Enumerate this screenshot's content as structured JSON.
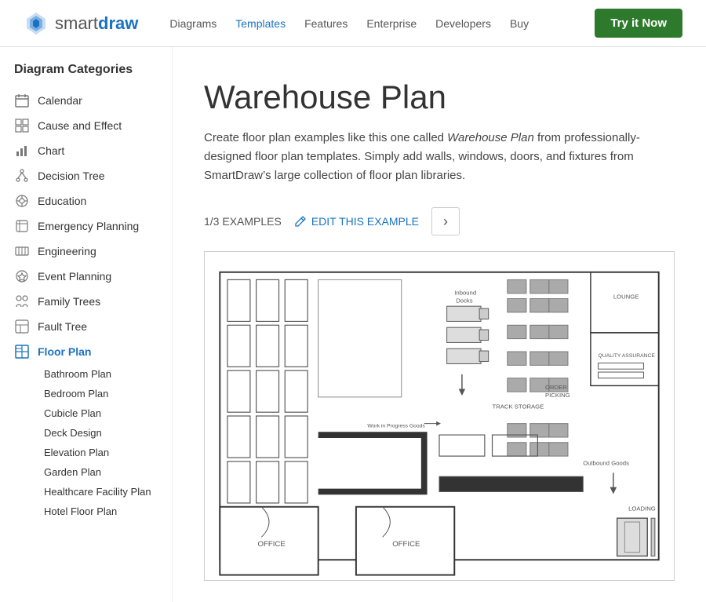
{
  "nav": {
    "brand_smart": "smart",
    "brand_draw": "draw",
    "links": [
      {
        "label": "Diagrams",
        "active": false
      },
      {
        "label": "Templates",
        "active": true
      },
      {
        "label": "Features",
        "active": false
      },
      {
        "label": "Enterprise",
        "active": false
      },
      {
        "label": "Developers",
        "active": false
      },
      {
        "label": "Buy",
        "active": false
      }
    ],
    "cta_label": "Try it Now"
  },
  "sidebar": {
    "title": "Diagram Categories",
    "items": [
      {
        "label": "Calendar",
        "icon": "calendar",
        "active": false
      },
      {
        "label": "Cause and Effect",
        "icon": "cause",
        "active": false
      },
      {
        "label": "Chart",
        "icon": "chart",
        "active": false
      },
      {
        "label": "Decision Tree",
        "icon": "tree",
        "active": false
      },
      {
        "label": "Education",
        "icon": "edu",
        "active": false
      },
      {
        "label": "Emergency Planning",
        "icon": "emergency",
        "active": false
      },
      {
        "label": "Engineering",
        "icon": "engineering",
        "active": false
      },
      {
        "label": "Event Planning",
        "icon": "event",
        "active": false
      },
      {
        "label": "Family Trees",
        "icon": "family",
        "active": false
      },
      {
        "label": "Fault Tree",
        "icon": "fault",
        "active": false
      },
      {
        "label": "Floor Plan",
        "icon": "floor",
        "active": true
      }
    ],
    "sub_items": [
      "Bathroom Plan",
      "Bedroom Plan",
      "Cubicle Plan",
      "Deck Design",
      "Elevation Plan",
      "Garden Plan",
      "Healthcare Facility Plan",
      "Hotel Floor Plan"
    ]
  },
  "main": {
    "title": "Warehouse Plan",
    "description_parts": [
      "Create floor plan examples like this one called ",
      "Warehouse Plan",
      " from professionally-designed floor plan templates. Simply add walls, windows, doors, and fixtures from SmartDraw’s large collection of floor plan libraries."
    ],
    "examples_count": "1/3 EXAMPLES",
    "edit_label": "EDIT THIS EXAMPLE",
    "next_arrow": "›"
  }
}
